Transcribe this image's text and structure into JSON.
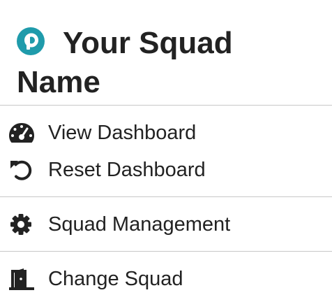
{
  "header": {
    "logo_icon": "squad-logo-icon",
    "logo_color": "#1f9bab",
    "title": "Your Squad Name"
  },
  "menu": {
    "groups": [
      {
        "items": [
          {
            "label": "View Dashboard",
            "icon": "dashboard-gauge-icon"
          },
          {
            "label": "Reset Dashboard",
            "icon": "reset-undo-icon"
          }
        ]
      },
      {
        "items": [
          {
            "label": "Squad Management",
            "icon": "gear-icon"
          }
        ]
      },
      {
        "items": [
          {
            "label": "Change Squad",
            "icon": "door-exit-icon"
          }
        ]
      }
    ]
  },
  "colors": {
    "text": "#222222",
    "divider": "#c8c8c8",
    "brand": "#1f9bab"
  }
}
